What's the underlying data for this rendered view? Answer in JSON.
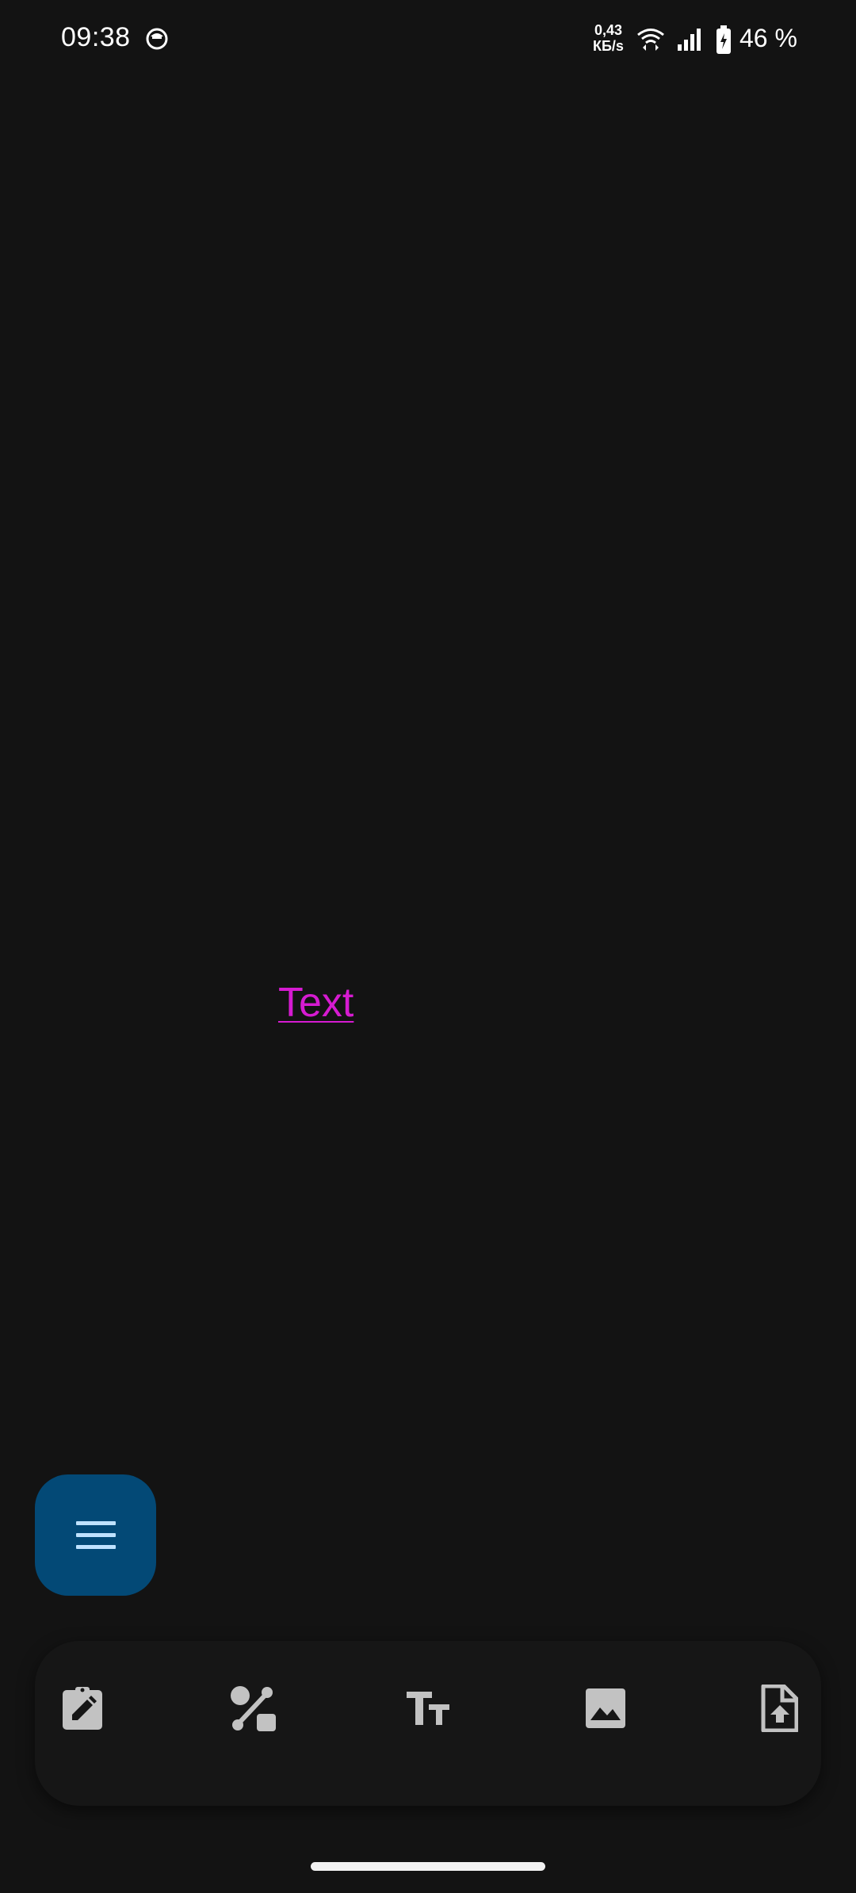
{
  "status_bar": {
    "time": "09:38",
    "net_speed_value": "0,43",
    "net_speed_unit": "КБ/s",
    "battery_percent": "46 %"
  },
  "canvas": {
    "text_item": "Text",
    "text_color": "#d61bd1",
    "background_color": "#131313"
  },
  "fab": {
    "icon": "menu-icon",
    "color": "#034976"
  },
  "toolbar": {
    "items": [
      {
        "icon": "edit-clipboard-icon"
      },
      {
        "icon": "shapes-icon"
      },
      {
        "icon": "text-size-icon"
      },
      {
        "icon": "image-icon"
      },
      {
        "icon": "file-upload-icon"
      }
    ]
  }
}
